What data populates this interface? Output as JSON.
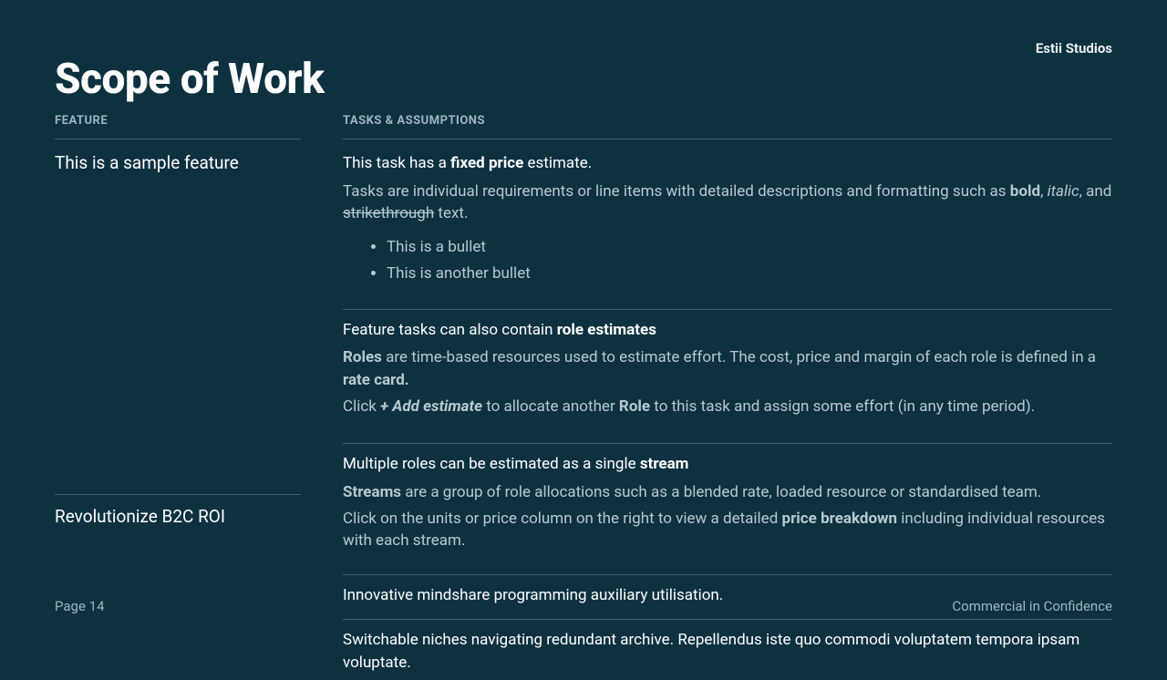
{
  "brand": "Estii Studios",
  "title": "Scope of Work",
  "headers": {
    "feature": "FEATURE",
    "tasks": "TASKS & ASSUMPTIONS"
  },
  "features": [
    {
      "name": "This is a sample feature",
      "tasks": [
        {
          "title_pre": "This task has a ",
          "title_bold": "fixed price",
          "title_post": " estimate.",
          "body_pre": "Tasks are individual requirements or line items with detailed descriptions and formatting such as ",
          "body_bold": "bold",
          "body_sep1": ", ",
          "body_italic": "italic",
          "body_sep2": ", and ",
          "body_strike": "strikethrough",
          "body_post": " text.",
          "bullets": [
            "This is a bullet",
            "This is another bullet"
          ]
        },
        {
          "title_pre": "Feature tasks can also contain ",
          "title_bold": "role estimates",
          "p1_bold": "Roles",
          "p1_mid": " are time-based resources used to estimate effort. The cost, price and margin of each role is defined in a ",
          "p1_bold2": "rate card.",
          "p2_pre": "Click ",
          "p2_bolditalic": "+ Add estimate",
          "p2_mid": " to allocate another ",
          "p2_bold": "Role",
          "p2_post": " to this task and assign some effort (in any time period)."
        },
        {
          "title_pre": "Multiple roles can be estimated as a single ",
          "title_bold": "stream",
          "p1_bold": "Streams",
          "p1_post": " are a group of role allocations such as a blended rate, loaded resource or standardised team.",
          "p2_pre": "Click on the units or price column on the right to view a detailed ",
          "p2_bold": "price breakdown",
          "p2_post": " including individual resources with each stream."
        }
      ]
    },
    {
      "name": "Revolutionize B2C ROI",
      "tasks": [
        {
          "title_plain": "Innovative mindshare programming auxiliary utilisation."
        },
        {
          "title_plain": "Switchable niches navigating redundant archive. Repellendus iste quo commodi voluptatem tempora ipsam voluptate."
        }
      ]
    }
  ],
  "footer": {
    "page": "Page 14",
    "confidential": "Commercial in Confidence"
  }
}
